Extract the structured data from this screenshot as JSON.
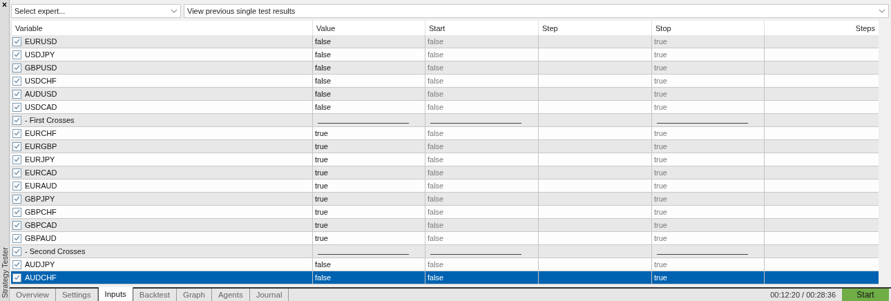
{
  "panel": {
    "close": "×",
    "title": "Strategy Tester"
  },
  "expert_select": {
    "placeholder": "Select expert..."
  },
  "results_select": {
    "value": "View previous single test results"
  },
  "table": {
    "columns": [
      "Variable",
      "Value",
      "Start",
      "Step",
      "Stop",
      "Steps"
    ],
    "rows": [
      {
        "kind": "param",
        "name": "EURUSD",
        "checked": true,
        "value": "false",
        "start": "false",
        "stop": "true",
        "selected": false
      },
      {
        "kind": "param",
        "name": "USDJPY",
        "checked": true,
        "value": "false",
        "start": "false",
        "stop": "true",
        "selected": false
      },
      {
        "kind": "param",
        "name": "GBPUSD",
        "checked": true,
        "value": "false",
        "start": "false",
        "stop": "true",
        "selected": false
      },
      {
        "kind": "param",
        "name": "USDCHF",
        "checked": true,
        "value": "false",
        "start": "false",
        "stop": "true",
        "selected": false
      },
      {
        "kind": "param",
        "name": "AUDUSD",
        "checked": true,
        "value": "false",
        "start": "false",
        "stop": "true",
        "selected": false
      },
      {
        "kind": "param",
        "name": "USDCAD",
        "checked": true,
        "value": "false",
        "start": "false",
        "stop": "true",
        "selected": false
      },
      {
        "kind": "group",
        "name": "- First Crosses",
        "checked": true,
        "selected": false
      },
      {
        "kind": "param",
        "name": "EURCHF",
        "checked": true,
        "value": "true",
        "start": "false",
        "stop": "true",
        "selected": false
      },
      {
        "kind": "param",
        "name": "EURGBP",
        "checked": true,
        "value": "true",
        "start": "false",
        "stop": "true",
        "selected": false
      },
      {
        "kind": "param",
        "name": "EURJPY",
        "checked": true,
        "value": "true",
        "start": "false",
        "stop": "true",
        "selected": false
      },
      {
        "kind": "param",
        "name": "EURCAD",
        "checked": true,
        "value": "true",
        "start": "false",
        "stop": "true",
        "selected": false
      },
      {
        "kind": "param",
        "name": "EURAUD",
        "checked": true,
        "value": "true",
        "start": "false",
        "stop": "true",
        "selected": false
      },
      {
        "kind": "param",
        "name": "GBPJPY",
        "checked": true,
        "value": "true",
        "start": "false",
        "stop": "true",
        "selected": false
      },
      {
        "kind": "param",
        "name": "GBPCHF",
        "checked": true,
        "value": "true",
        "start": "false",
        "stop": "true",
        "selected": false
      },
      {
        "kind": "param",
        "name": "GBPCAD",
        "checked": true,
        "value": "true",
        "start": "false",
        "stop": "true",
        "selected": false
      },
      {
        "kind": "param",
        "name": "GBPAUD",
        "checked": true,
        "value": "true",
        "start": "false",
        "stop": "true",
        "selected": false
      },
      {
        "kind": "group",
        "name": "- Second Crosses",
        "checked": true,
        "selected": false
      },
      {
        "kind": "param",
        "name": "AUDJPY",
        "checked": true,
        "value": "false",
        "start": "false",
        "stop": "true",
        "selected": false
      },
      {
        "kind": "param",
        "name": "AUDCHF",
        "checked": true,
        "value": "false",
        "start": "false",
        "stop": "true",
        "selected": true
      }
    ]
  },
  "tabs": [
    {
      "label": "Overview",
      "selected": false
    },
    {
      "label": "Settings",
      "selected": false
    },
    {
      "label": "Inputs",
      "selected": true
    },
    {
      "label": "Backtest",
      "selected": false
    },
    {
      "label": "Graph",
      "selected": false
    },
    {
      "label": "Agents",
      "selected": false
    },
    {
      "label": "Journal",
      "selected": false
    }
  ],
  "status": {
    "time": "00:12:20 / 00:28:36",
    "start_button": "Start"
  }
}
